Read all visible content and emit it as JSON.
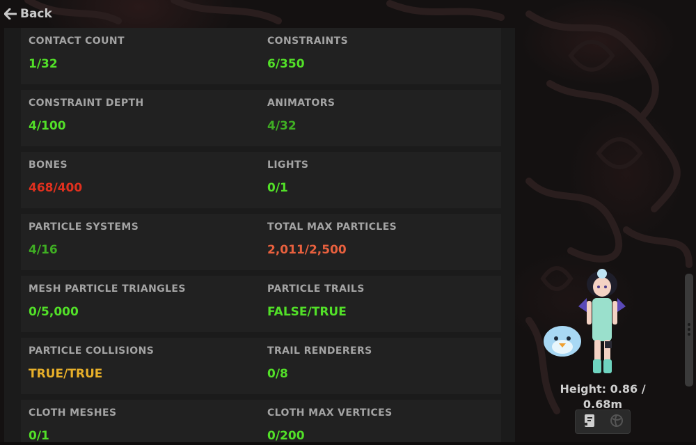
{
  "nav": {
    "back_label": "Back"
  },
  "colors": {
    "good": "#52e028",
    "ok": "#3fae23",
    "bad": "#e0301e",
    "warn": "#e8603e",
    "caution": "#e8b02a",
    "label": "#a4a4a4",
    "panel": "#1b1b1b",
    "row": "#212121"
  },
  "stats": [
    {
      "left": {
        "label": "CONTACT COUNT",
        "value": "1/32",
        "status": "good"
      },
      "right": {
        "label": "CONSTRAINTS",
        "value": "6/350",
        "status": "good"
      }
    },
    {
      "left": {
        "label": "CONSTRAINT DEPTH",
        "value": "4/100",
        "status": "good"
      },
      "right": {
        "label": "ANIMATORS",
        "value": "4/32",
        "status": "ok"
      }
    },
    {
      "left": {
        "label": "BONES",
        "value": "468/400",
        "status": "bad"
      },
      "right": {
        "label": "LIGHTS",
        "value": "0/1",
        "status": "good"
      }
    },
    {
      "left": {
        "label": "PARTICLE SYSTEMS",
        "value": "4/16",
        "status": "ok"
      },
      "right": {
        "label": "TOTAL MAX PARTICLES",
        "value": "2,011/2,500",
        "status": "warn"
      }
    },
    {
      "left": {
        "label": "MESH PARTICLE TRIANGLES",
        "value": "0/5,000",
        "status": "good"
      },
      "right": {
        "label": "PARTICLE TRAILS",
        "value": "FALSE/TRUE",
        "status": "good"
      }
    },
    {
      "left": {
        "label": "PARTICLE COLLISIONS",
        "value": "TRUE/TRUE",
        "status": "caution"
      },
      "right": {
        "label": "TRAIL RENDERERS",
        "value": "0/8",
        "status": "good"
      }
    },
    {
      "left": {
        "label": "CLOTH MESHES",
        "value": "0/1",
        "status": "good"
      },
      "right": {
        "label": "CLOTH MAX VERTICES",
        "value": "0/200",
        "status": "good"
      }
    }
  ],
  "avatar": {
    "height_text": "Height: 0.86 / 0.68m",
    "tools": [
      {
        "icon": "book-icon"
      },
      {
        "icon": "globe-icon"
      }
    ]
  }
}
